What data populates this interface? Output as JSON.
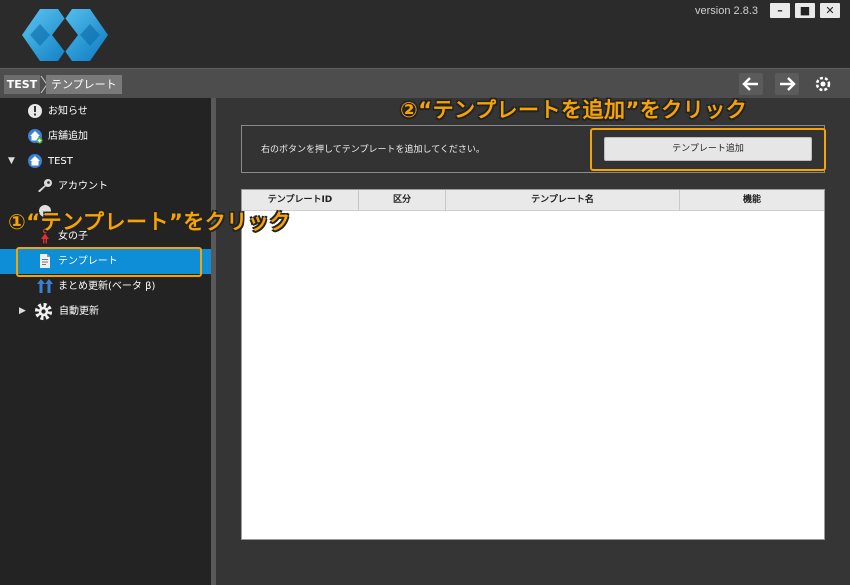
{
  "titlebar": {
    "version": "version 2.8.3",
    "minimize_glyph": "–",
    "maximize_glyph": "■",
    "close_glyph": "✕",
    "brand_color": "#1aa1e3"
  },
  "breadcrumb": {
    "root": "TEST",
    "current": "テンプレート"
  },
  "nav": {
    "back_icon": "arrow-left-icon",
    "forward_icon": "arrow-right-icon",
    "settings_icon": "gear-icon"
  },
  "sidebar": {
    "items": [
      {
        "label": "お知らせ",
        "icon": "info-icon"
      },
      {
        "label": "店舗追加",
        "icon": "add-store-icon"
      },
      {
        "label": "TEST",
        "icon": "home-icon",
        "expanded": true
      },
      {
        "label": "アカウント",
        "icon": "key-icon"
      },
      {
        "label": "",
        "icon": "partially-hidden-item-icon"
      },
      {
        "label": "女の子",
        "icon": "woman-icon"
      },
      {
        "label": "テンプレート",
        "icon": "template-icon",
        "selected": true
      },
      {
        "label": "まとめ更新(ベータ β)",
        "icon": "bulk-update-icon"
      },
      {
        "label": "自動更新",
        "icon": "gear-icon",
        "expanded": false
      }
    ],
    "selected_color": "#0d8ed6"
  },
  "main": {
    "info_text": "右のボタンを押してテンプレートを追加してください。",
    "add_button": "テンプレート追加",
    "table": {
      "columns": [
        "テンプレートID",
        "区分",
        "テンプレート名",
        "機能"
      ],
      "rows": []
    }
  },
  "annotations": {
    "step1": "①“テンプレート”をクリック",
    "step2": "②“テンプレートを追加”をクリック",
    "color": "#f7a400"
  }
}
